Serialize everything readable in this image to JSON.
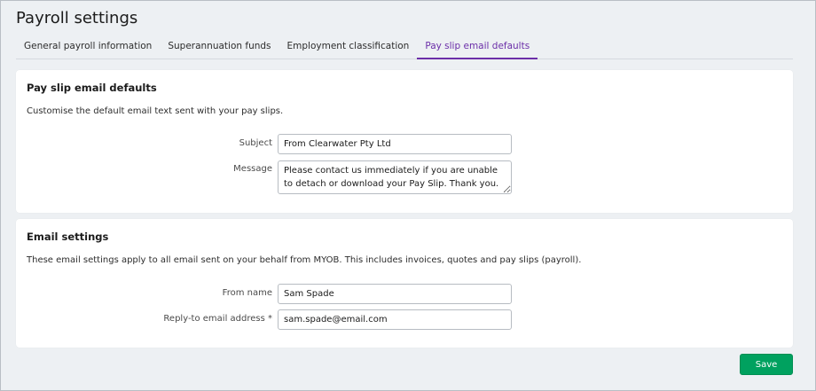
{
  "page": {
    "title": "Payroll settings"
  },
  "tabs": [
    {
      "label": "General payroll information"
    },
    {
      "label": "Superannuation funds"
    },
    {
      "label": "Employment classification"
    },
    {
      "label": "Pay slip email defaults",
      "active": true
    }
  ],
  "payslip_section": {
    "title": "Pay slip email defaults",
    "description": "Customise the default email text sent with your pay slips.",
    "subject_label": "Subject",
    "subject_value": "From Clearwater Pty Ltd",
    "message_label": "Message",
    "message_value": "Please contact us immediately if you are unable to detach or download your Pay Slip. Thank you."
  },
  "email_section": {
    "title": "Email settings",
    "description": "These email settings apply to all email sent on your behalf from MYOB. This includes invoices, quotes and pay slips (payroll).",
    "from_name_label": "From name",
    "from_name_value": "Sam Spade",
    "reply_to_label": "Reply-to email address *",
    "reply_to_value": "sam.spade@email.com"
  },
  "actions": {
    "save_label": "Save"
  },
  "colors": {
    "accent": "#6b2ea8",
    "save_button": "#00a15f"
  }
}
